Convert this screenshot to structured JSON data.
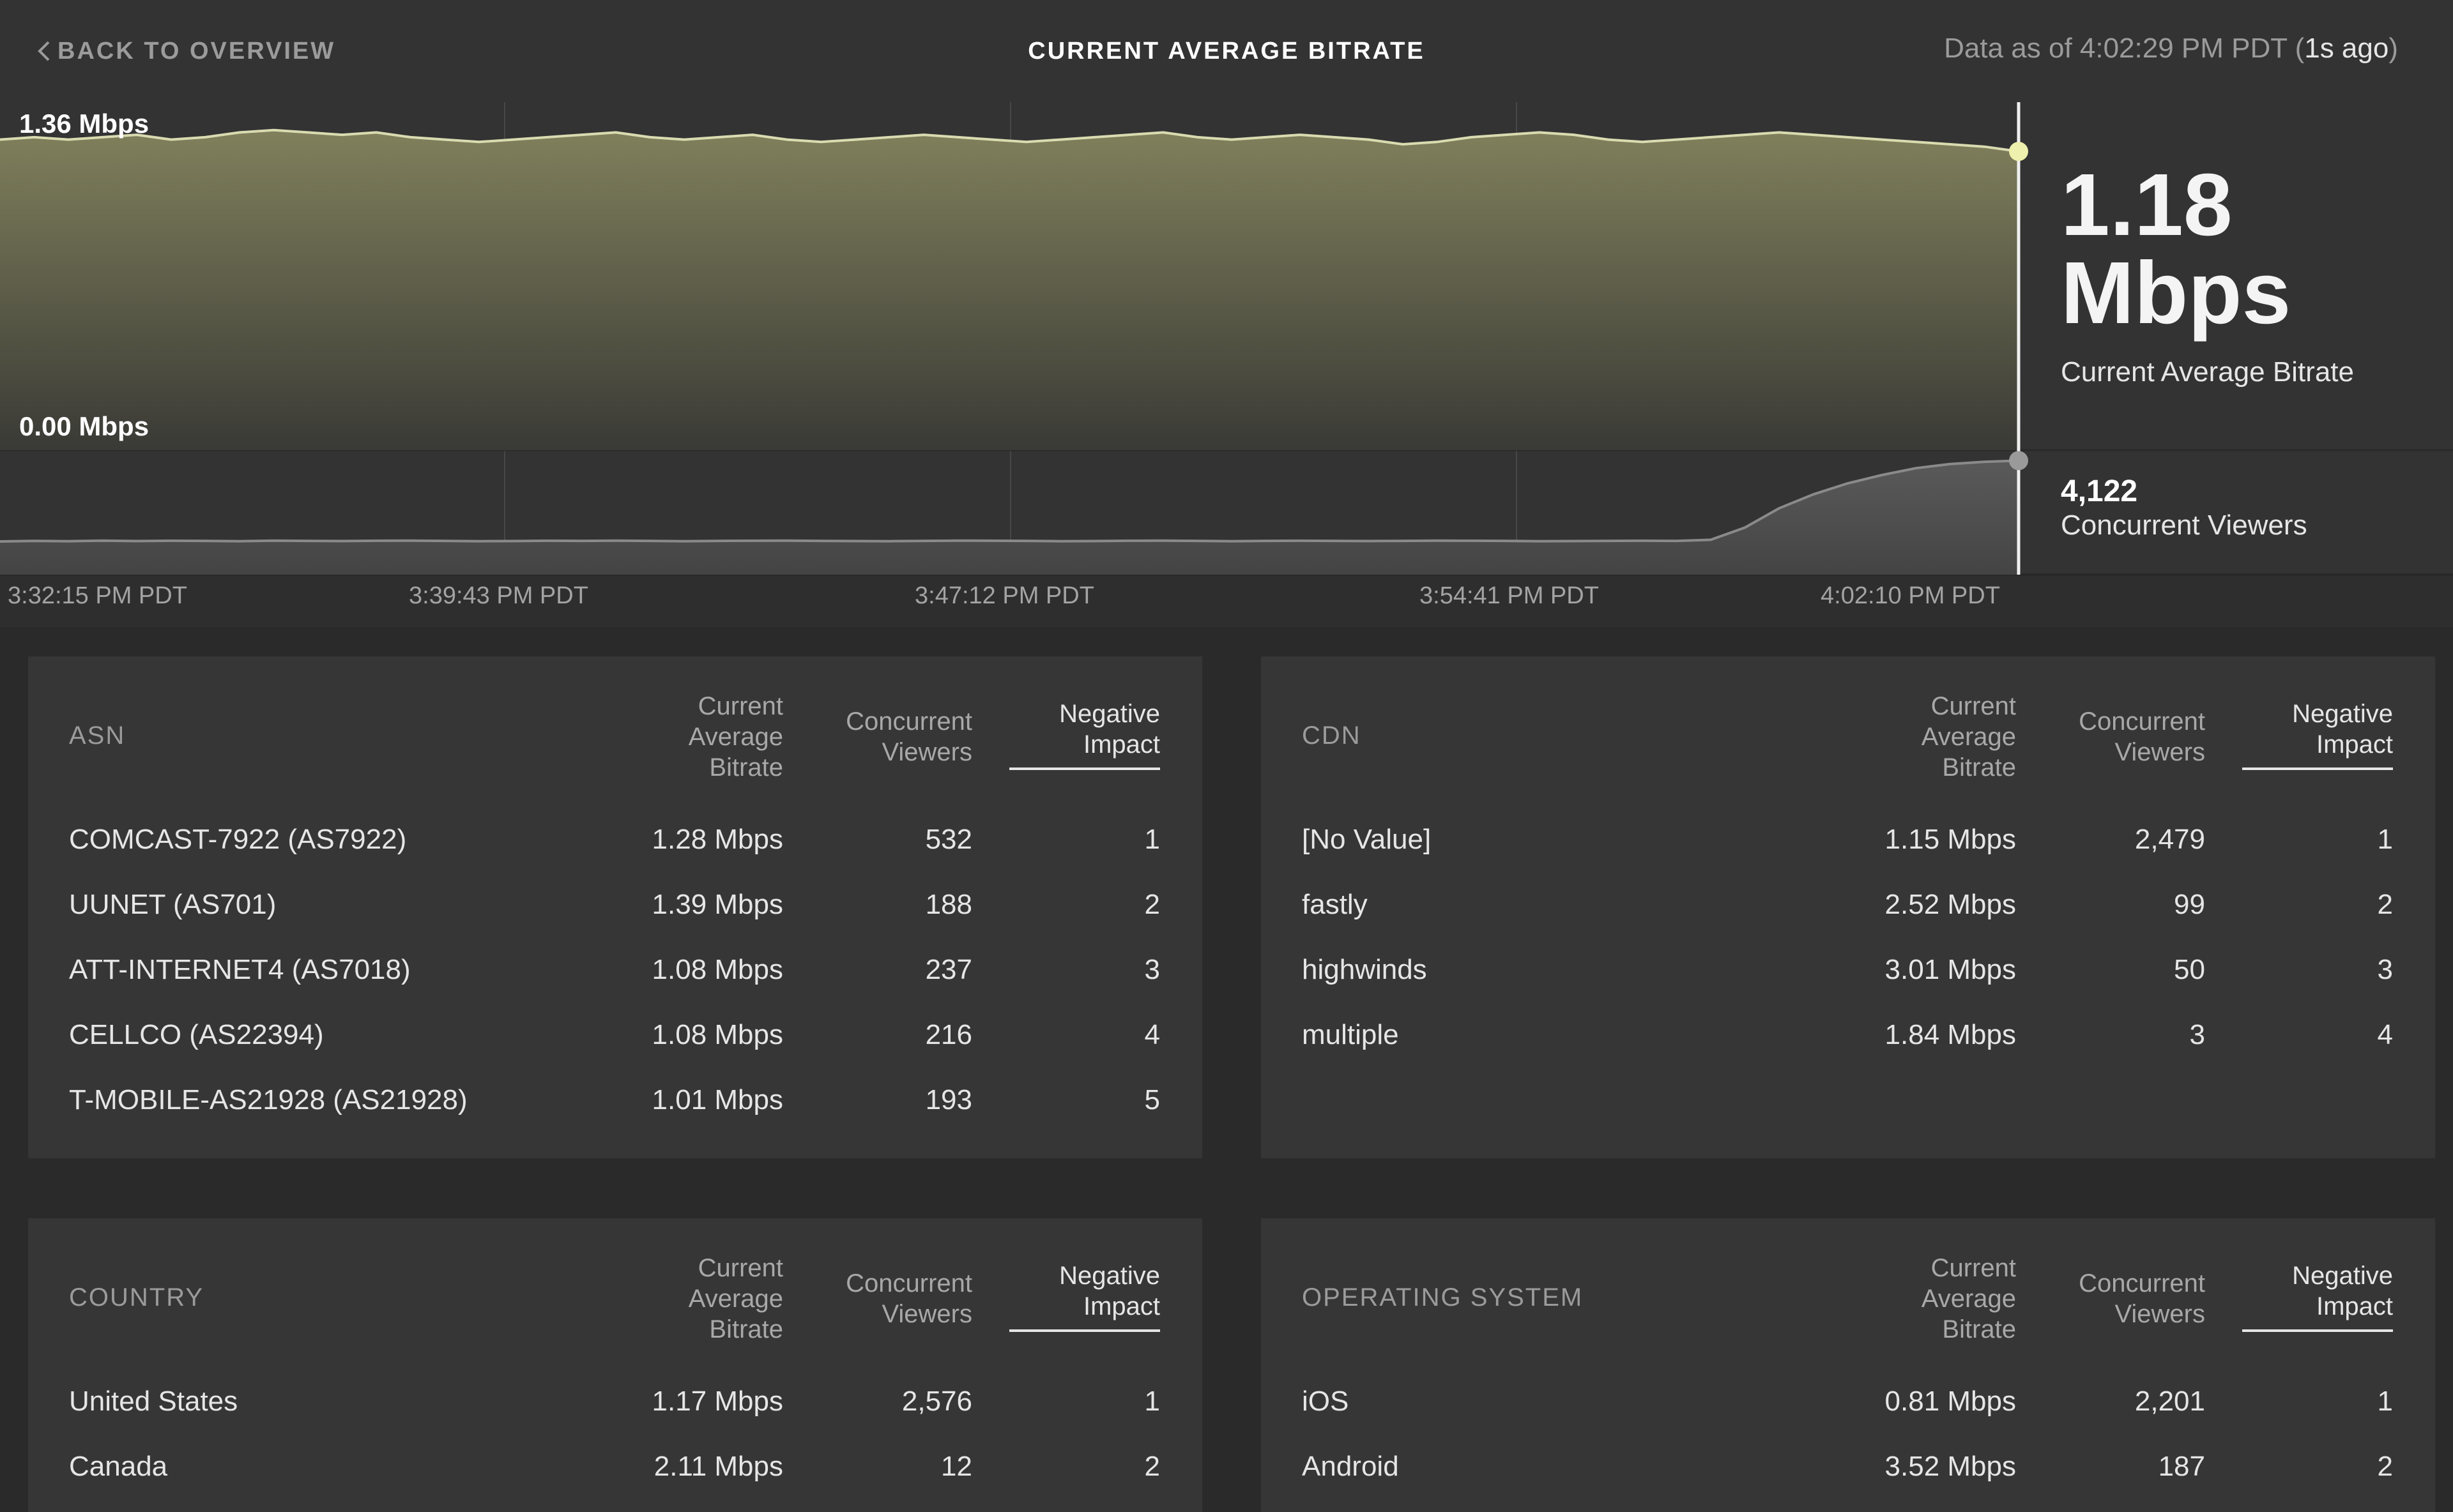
{
  "header": {
    "back_label": "BACK TO OVERVIEW",
    "title": "CURRENT AVERAGE BITRATE",
    "as_of_prefix": "Data as of 4:02:29 PM PDT (",
    "as_of_ago": "1s ago",
    "as_of_suffix": ")"
  },
  "summary": {
    "bitrate_value": "1.18 Mbps",
    "bitrate_label": "Current Average Bitrate",
    "viewers_value": "4,122",
    "viewers_label": "Concurrent Viewers"
  },
  "colors": {
    "accent": "#eef0ad",
    "bitrate_line": "#d9dbb0",
    "viewers_line": "#8a8a8a",
    "background": "#2a2a2a"
  },
  "chart_data": [
    {
      "type": "area",
      "ylabel_top": "1.36 Mbps",
      "ylabel_bottom": "0.00 Mbps",
      "ylim": [
        0,
        1.36
      ],
      "x_ticks": [
        "3:32:15 PM PDT",
        "3:39:43 PM PDT",
        "3:47:12 PM PDT",
        "3:54:41 PM PDT",
        "4:02:10 PM PDT"
      ],
      "series": [
        {
          "values": [
            1.31,
            1.32,
            1.31,
            1.32,
            1.33,
            1.31,
            1.32,
            1.34,
            1.35,
            1.34,
            1.33,
            1.34,
            1.32,
            1.31,
            1.3,
            1.31,
            1.32,
            1.33,
            1.34,
            1.32,
            1.31,
            1.32,
            1.33,
            1.31,
            1.3,
            1.31,
            1.32,
            1.33,
            1.32,
            1.31,
            1.3,
            1.31,
            1.32,
            1.33,
            1.34,
            1.32,
            1.31,
            1.32,
            1.33,
            1.32,
            1.31,
            1.29,
            1.3,
            1.32,
            1.33,
            1.34,
            1.33,
            1.31,
            1.3,
            1.31,
            1.32,
            1.33,
            1.34,
            1.33,
            1.32,
            1.31,
            1.3,
            1.29,
            1.28,
            1.26
          ]
        }
      ]
    },
    {
      "type": "area",
      "series": [
        {
          "values": [
            1200,
            1220,
            1210,
            1230,
            1215,
            1225,
            1220,
            1210,
            1230,
            1220,
            1215,
            1225,
            1230,
            1220,
            1210,
            1215,
            1225,
            1220,
            1230,
            1220,
            1210,
            1220,
            1225,
            1230,
            1220,
            1215,
            1210,
            1220,
            1230,
            1225,
            1220,
            1210,
            1215,
            1225,
            1230,
            1220,
            1210,
            1220,
            1225,
            1220,
            1215,
            1220,
            1230,
            1225,
            1220,
            1210,
            1215,
            1220,
            1225,
            1220,
            1260,
            1700,
            2400,
            2900,
            3300,
            3600,
            3850,
            4000,
            4080,
            4122
          ]
        }
      ],
      "ylim": [
        0,
        4500
      ]
    }
  ],
  "tables": {
    "col_bitrate": "Current Average Bitrate",
    "col_viewers": "Concurrent Viewers",
    "col_impact": "Negative Impact",
    "asn": {
      "title": "ASN",
      "rows": [
        {
          "name": "COMCAST-7922 (AS7922)",
          "bitrate": "1.28 Mbps",
          "viewers": "532",
          "impact": "1"
        },
        {
          "name": "UUNET (AS701)",
          "bitrate": "1.39 Mbps",
          "viewers": "188",
          "impact": "2"
        },
        {
          "name": "ATT-INTERNET4 (AS7018)",
          "bitrate": "1.08 Mbps",
          "viewers": "237",
          "impact": "3"
        },
        {
          "name": "CELLCO (AS22394)",
          "bitrate": "1.08 Mbps",
          "viewers": "216",
          "impact": "4"
        },
        {
          "name": "T-MOBILE-AS21928 (AS21928)",
          "bitrate": "1.01 Mbps",
          "viewers": "193",
          "impact": "5"
        }
      ]
    },
    "cdn": {
      "title": "CDN",
      "rows": [
        {
          "name": "[No Value]",
          "bitrate": "1.15 Mbps",
          "viewers": "2,479",
          "impact": "1"
        },
        {
          "name": "fastly",
          "bitrate": "2.52 Mbps",
          "viewers": "99",
          "impact": "2"
        },
        {
          "name": "highwinds",
          "bitrate": "3.01 Mbps",
          "viewers": "50",
          "impact": "3"
        },
        {
          "name": "multiple",
          "bitrate": "1.84 Mbps",
          "viewers": "3",
          "impact": "4"
        }
      ]
    },
    "country": {
      "title": "COUNTRY",
      "rows": [
        {
          "name": "United States",
          "bitrate": "1.17 Mbps",
          "viewers": "2,576",
          "impact": "1"
        },
        {
          "name": "Canada",
          "bitrate": "2.11 Mbps",
          "viewers": "12",
          "impact": "2"
        }
      ]
    },
    "os": {
      "title": "OPERATING SYSTEM",
      "rows": [
        {
          "name": "iOS",
          "bitrate": "0.81 Mbps",
          "viewers": "2,201",
          "impact": "1"
        },
        {
          "name": "Android",
          "bitrate": "3.52 Mbps",
          "viewers": "187",
          "impact": "2"
        }
      ]
    }
  }
}
